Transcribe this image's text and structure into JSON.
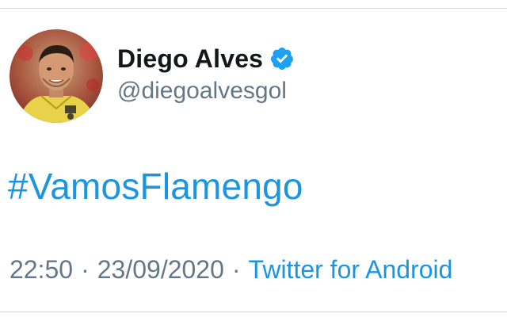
{
  "tweet": {
    "author": {
      "display_name": "Diego Alves",
      "handle": "@diegoalvesgol",
      "verified": true,
      "avatar_icon": "profile-photo-goalkeeper",
      "verified_icon": "verified-badge-icon"
    },
    "text": "#VamosFlamengo",
    "time": "22:50",
    "separator": "·",
    "date": "23/09/2020",
    "source": "Twitter for Android"
  },
  "colors": {
    "name": "#14171a",
    "secondary": "#657786",
    "link": "#1b95e0",
    "verified": "#1da1f2",
    "divider": "#d9d9d9"
  }
}
